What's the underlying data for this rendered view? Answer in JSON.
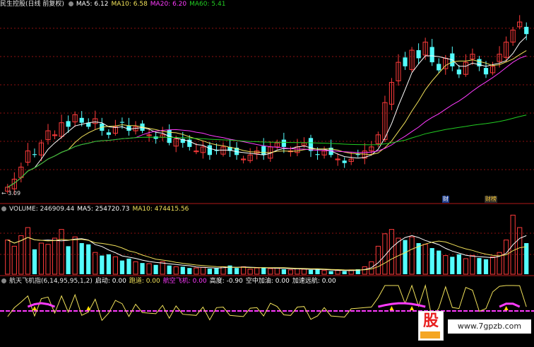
{
  "main_header": {
    "title": "民生控股(日线 前复权)",
    "ma5_label": "MA5: 6.12",
    "ma10_label": "MA10: 6.58",
    "ma20_label": "MA20: 6.20",
    "ma60_label": "MA60: 5.41"
  },
  "price_low_label": "← 3.09",
  "event_tags": [
    "财",
    "财榜"
  ],
  "volume_header": {
    "volume_label": "VOLUME: 246909.44",
    "ma5_label": "MA5: 254720.73",
    "ma10_label": "MA10: 474415.56"
  },
  "indicator_header": {
    "name": "航天飞机指(6,14,95,95,1,2)",
    "start": "启动: 0.00",
    "runway": "跑道: 0.00",
    "plane": "航空飞机: 0.00",
    "height": "高度: -0.90",
    "refuel": "空中加油: 0.00",
    "accel": "加速远航: 0.00"
  },
  "watermark": {
    "logo_text": "股",
    "url": "www.7gpzb.com"
  },
  "colors": {
    "up": "#ff3b3b",
    "down": "#54ffff",
    "ma5": "#ffffff",
    "ma10": "#f2e25a",
    "ma20": "#ff3bff",
    "ma60": "#22cc22",
    "grid": "#8b1010",
    "indicator_base": "#ff3bff"
  },
  "chart_data": {
    "type": "candlestick",
    "price_low_marker": 3.09,
    "price_closes": [
      3.2,
      3.4,
      3.7,
      4.1,
      4.0,
      4.3,
      4.6,
      4.5,
      4.8,
      4.7,
      5.0,
      4.8,
      4.7,
      4.9,
      4.6,
      4.5,
      4.7,
      4.8,
      4.6,
      4.7,
      4.6,
      4.5,
      4.4,
      4.5,
      4.3,
      4.4,
      4.3,
      4.2,
      4.1,
      4.2,
      4.0,
      4.1,
      4.2,
      4.1,
      4.0,
      3.9,
      4.0,
      4.1,
      4.0,
      4.2,
      4.3,
      4.2,
      4.1,
      4.2,
      4.3,
      4.1,
      4.0,
      4.1,
      4.0,
      3.9,
      3.8,
      3.9,
      4.0,
      4.1,
      4.2,
      4.5,
      5.3,
      5.8,
      6.3,
      6.2,
      6.6,
      6.4,
      6.8,
      6.3,
      6.1,
      6.4,
      6.2,
      6.0,
      6.3,
      6.5,
      6.2,
      6.0,
      6.2,
      6.5,
      6.8,
      7.1,
      7.3,
      7.0
    ],
    "ma_current": {
      "MA5": 6.12,
      "MA10": 6.58,
      "MA20": 6.2,
      "MA60": 5.41
    },
    "volume_current": 246909.44,
    "volume_ma": {
      "MA5": 254720.73,
      "MA10": 474415.56
    },
    "volume_bars": [
      0.55,
      0.45,
      0.62,
      0.75,
      0.4,
      0.5,
      0.48,
      0.58,
      0.72,
      0.45,
      0.6,
      0.5,
      0.48,
      0.35,
      0.3,
      0.32,
      0.28,
      0.22,
      0.25,
      0.2,
      0.18,
      0.17,
      0.15,
      0.2,
      0.14,
      0.12,
      0.12,
      0.1,
      0.1,
      0.11,
      0.09,
      0.1,
      0.12,
      0.14,
      0.1,
      0.12,
      0.08,
      0.1,
      0.11,
      0.09,
      0.1,
      0.08,
      0.07,
      0.09,
      0.08,
      0.07,
      0.08,
      0.06,
      0.05,
      0.06,
      0.05,
      0.07,
      0.08,
      0.12,
      0.2,
      0.45,
      0.65,
      0.72,
      0.58,
      0.55,
      0.6,
      0.5,
      0.48,
      0.42,
      0.38,
      0.3,
      0.28,
      0.32,
      0.25,
      0.3,
      0.26,
      0.24,
      0.28,
      0.35,
      0.55,
      0.95,
      0.75,
      0.5
    ],
    "indicator": {
      "start": 0.0,
      "runway": 0.0,
      "plane": 0.0,
      "height": -0.9,
      "refuel": 0.0,
      "accel": 0.0
    }
  }
}
